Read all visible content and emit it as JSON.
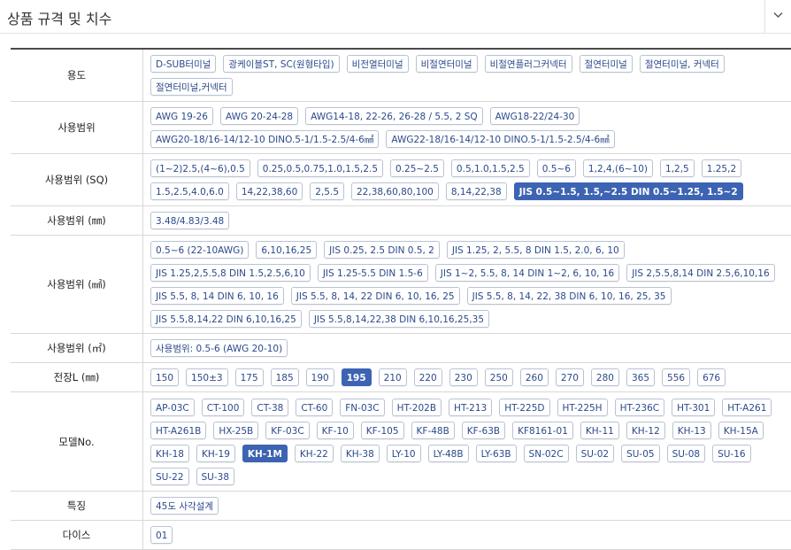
{
  "header": {
    "title": "상품 규격 및 치수",
    "toggle_icon": "chevron-down-icon"
  },
  "colors": {
    "chip_text": "#2b4a8b",
    "chip_border": "#b9c3d4",
    "selected_bg": "#3d63b3"
  },
  "rows": [
    {
      "label": "용도",
      "chips": [
        "D-SUB터미널",
        "광케이블ST, SC(원형타입)",
        "비전열터미널",
        "비절연터미널",
        "비절연플러그커넥터",
        "절연터미널",
        "절연터미널, 커넥터",
        "절연터미널,커넥터"
      ],
      "selected": []
    },
    {
      "label": "사용범위",
      "chips": [
        "AWG 19-26",
        "AWG 20-24-28",
        "AWG14-18, 22-26, 26-28 / 5.5, 2 SQ",
        "AWG18-22/24-30",
        "AWG20-18/16-14/12-10 DINO.5-1/1.5-2.5/4-6㎟",
        "AWG22-18/16-14/12-10 DINO.5-1/1.5-2.5/4-6㎟"
      ],
      "selected": []
    },
    {
      "label": "사용범위 (SQ)",
      "chips": [
        "(1~2)2.5,(4~6),0.5",
        "0.25,0.5,0.75,1.0,1.5,2.5",
        "0.25~2.5",
        "0.5,1.0,1.5,2.5",
        "0.5~6",
        "1,2,4,(6~10)",
        "1,2,5",
        "1.25,2",
        "1.5,2.5,4.0,6.0",
        "14,22,38,60",
        "2,5.5",
        "22,38,60,80,100",
        "8,14,22,38",
        "JIS 0.5~1.5, 1.5,~2.5 DIN 0.5~1.25, 1.5~2"
      ],
      "selected": [
        13
      ]
    },
    {
      "label": "사용범위 (㎜)",
      "chips": [
        "3.48/4.83/3.48"
      ],
      "selected": []
    },
    {
      "label": "사용범위 (㎟)",
      "chips": [
        "0.5~6 (22-10AWG)",
        "6,10,16,25",
        "JIS 0.25, 2.5 DIN 0.5, 2",
        "JIS 1.25, 2, 5.5, 8 DIN 1.5, 2.0, 6, 10",
        "JIS 1.25,2,5.5,8 DIN 1.5,2.5,6,10",
        "JIS 1.25-5.5 DIN 1.5-6",
        "JIS 1~2, 5.5, 8, 14 DIN 1~2, 6, 10, 16",
        "JIS 2,5.5,8,14 DIN 2.5,6,10,16",
        "JIS 5.5, 8, 14 DIN 6, 10, 16",
        "JIS 5.5, 8, 14, 22 DIN 6, 10, 16, 25",
        "JIS 5.5, 8, 14, 22, 38 DIN 6, 10, 16, 25, 35",
        "JIS 5.5,8,14,22 DIN 6,10,16,25",
        "JIS 5.5,8,14,22,38 DIN 6,10,16,25,35"
      ],
      "selected": []
    },
    {
      "label": "사용범위 (㎡)",
      "chips": [
        "사용범위: 0.5-6 (AWG 20-10)"
      ],
      "selected": []
    },
    {
      "label": "전장L (㎜)",
      "chips": [
        "150",
        "150±3",
        "175",
        "185",
        "190",
        "195",
        "210",
        "220",
        "230",
        "250",
        "260",
        "270",
        "280",
        "365",
        "556",
        "676"
      ],
      "selected": [
        5
      ]
    },
    {
      "label": "모델No.",
      "chips": [
        "AP-03C",
        "CT-100",
        "CT-38",
        "CT-60",
        "FN-03C",
        "HT-202B",
        "HT-213",
        "HT-225D",
        "HT-225H",
        "HT-236C",
        "HT-301",
        "HT-A261",
        "HT-A261B",
        "HX-25B",
        "KF-03C",
        "KF-10",
        "KF-105",
        "KF-48B",
        "KF-63B",
        "KF8161-01",
        "KH-11",
        "KH-12",
        "KH-13",
        "KH-15A",
        "KH-18",
        "KH-19",
        "KH-1M",
        "KH-22",
        "KH-38",
        "LY-10",
        "LY-48B",
        "LY-63B",
        "SN-02C",
        "SU-02",
        "SU-05",
        "SU-08",
        "SU-16",
        "SU-22",
        "SU-38"
      ],
      "selected": [
        26
      ]
    },
    {
      "label": "특징",
      "chips": [
        "45도 사각설계"
      ],
      "selected": []
    },
    {
      "label": "다이스",
      "chips": [
        "01"
      ],
      "selected": []
    }
  ]
}
